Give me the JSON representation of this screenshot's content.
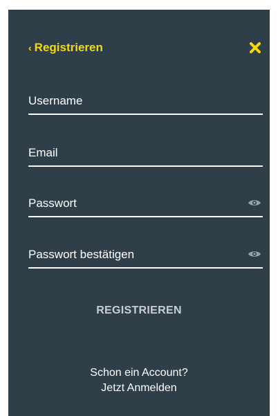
{
  "colors": {
    "background": "#2e3f49",
    "accent": "#f5d90a",
    "text": "#ffffff",
    "muted_icon": "#9aa3a9"
  },
  "header": {
    "back_label": "Registrieren",
    "back_icon": "chevron-left-icon",
    "close_icon": "close-icon"
  },
  "form": {
    "username": {
      "value": "",
      "placeholder": "Username"
    },
    "email": {
      "value": "",
      "placeholder": "Email"
    },
    "password": {
      "value": "",
      "placeholder": "Passwort",
      "toggle_icon": "eye-icon"
    },
    "password_confirm": {
      "value": "",
      "placeholder": "Passwort bestätigen",
      "toggle_icon": "eye-icon"
    },
    "submit_label": "REGISTRIEREN"
  },
  "footer": {
    "prompt": "Schon ein Account?",
    "login_link": "Jetzt Anmelden"
  }
}
